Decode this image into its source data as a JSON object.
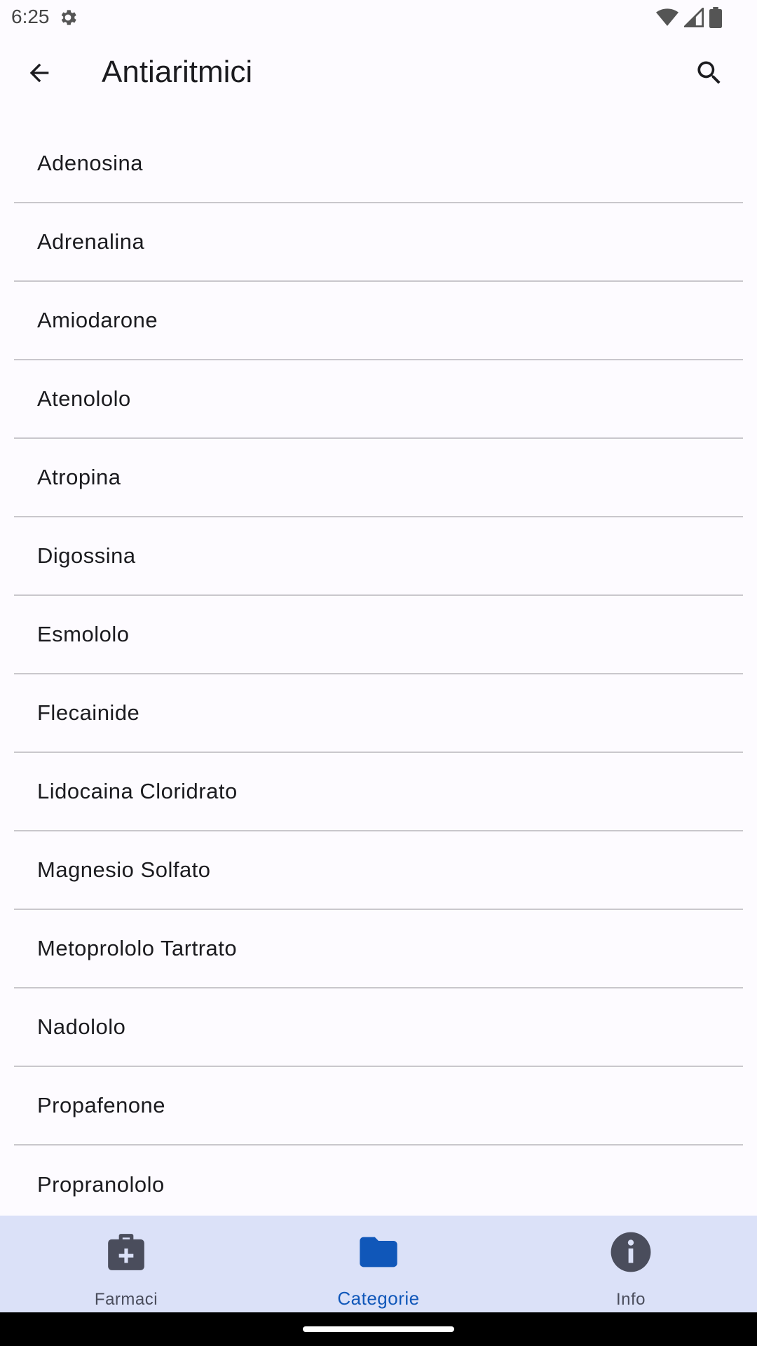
{
  "status": {
    "time": "6:25"
  },
  "app_bar": {
    "title": "Antiaritmici"
  },
  "items": [
    {
      "label": "Adenosina"
    },
    {
      "label": "Adrenalina"
    },
    {
      "label": "Amiodarone"
    },
    {
      "label": "Atenololo"
    },
    {
      "label": "Atropina"
    },
    {
      "label": "Digossina"
    },
    {
      "label": "Esmololo"
    },
    {
      "label": "Flecainide"
    },
    {
      "label": "Lidocaina Cloridrato"
    },
    {
      "label": "Magnesio Solfato"
    },
    {
      "label": "Metoprololo Tartrato"
    },
    {
      "label": "Nadololo"
    },
    {
      "label": "Propafenone"
    },
    {
      "label": "Propranololo"
    }
  ],
  "nav": [
    {
      "label": "Farmaci",
      "icon": "medical-kit-icon",
      "active": false
    },
    {
      "label": "Categorie",
      "icon": "folder-icon",
      "active": true
    },
    {
      "label": "Info",
      "icon": "info-icon",
      "active": false
    }
  ],
  "colors": {
    "accent": "#1057b9",
    "nav_bg": "#dbe1f8",
    "background": "#fdfbff"
  }
}
